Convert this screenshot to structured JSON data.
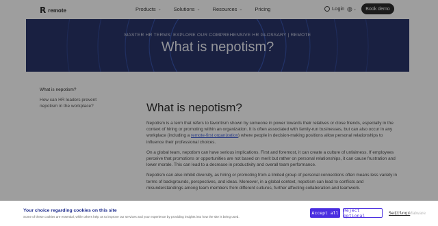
{
  "header": {
    "brand": "remote",
    "nav": [
      {
        "label": "Products",
        "has_dropdown": true
      },
      {
        "label": "Solutions",
        "has_dropdown": true
      },
      {
        "label": "Resources",
        "has_dropdown": true
      },
      {
        "label": "Pricing",
        "has_dropdown": false
      }
    ],
    "login_label": "Login",
    "cta_label": "Book demo"
  },
  "hero": {
    "eyebrow": "MASTER HR TERMS: EXPLORE OUR COMPREHENSIVE HR GLOSSARY | REMOTE",
    "title": "What is nepotism?"
  },
  "toc": {
    "items": [
      {
        "label": "What is nepotism?",
        "active": true
      },
      {
        "label": "How can HR leaders prevent nepotism in the workplace?",
        "active": false
      }
    ]
  },
  "article": {
    "heading": "What is nepotism?",
    "p1_before": "Nepotism is a term that refers to favoritism shown by someone in power towards their relatives or close friends, especially in the context of hiring or promoting within an organization. It is often associated with family-run businesses, but can also occur in any workplace (including a ",
    "p1_link": "remote-first organization",
    "p1_after": ") where people in decision-making positions allow personal relationships to influence their professional choices.",
    "p2": "On a global team, nepotism can have serious implications. First and foremost, it can create a culture of unfairness. If employees perceive that promotions or opportunities are not based on merit but rather on personal relationships, it can cause frustration and lower morale. This can lead to a decrease in productivity and overall team performance.",
    "p3": "Nepotism can also inhibit diversity, as hiring or promoting from a limited group of personal connections often means less variety in terms of backgrounds, perspectives, and ideas. Moreover, in a global context, nepotism can lead to conflicts and misunderstandings among team members from different cultures, further affecting collaboration and teamwork."
  },
  "cookie": {
    "title": "Your choice regarding cookies on this site",
    "description": "Some of these cookies are essential, while others help us to improve our services and your experience by providing insights into how the site is being used.",
    "accept_label": "Accept all",
    "reject_label": "Reject optional",
    "settings_label": "Settings"
  },
  "watermark": "@ScanMalware",
  "colors": {
    "hero_bg": "#0d1a57",
    "accent": "#4a2ee0",
    "cookie_title": "#1c2a8c"
  }
}
